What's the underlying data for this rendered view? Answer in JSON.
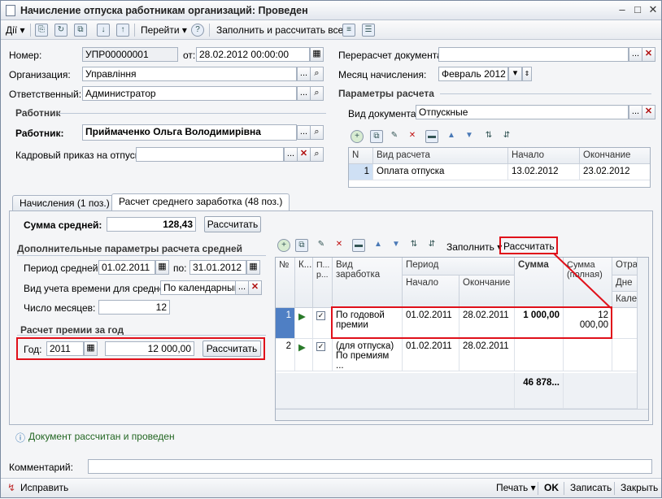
{
  "window": {
    "title": "Начисление отпуска работникам организаций: Проведен"
  },
  "toolbar": {
    "actions": "Дії",
    "goto": "Перейти",
    "fill_calc": "Заполнить и рассчитать все"
  },
  "header": {
    "number_label": "Номер:",
    "number": "УПР00000001",
    "date_label": "от:",
    "date": "28.02.2012 00:00:00",
    "org_label": "Организация:",
    "org": "Управління",
    "resp_label": "Ответственный:",
    "resp": "Администратор",
    "recalc_label": "Перерасчет документа:",
    "recalc": "",
    "month_label": "Месяц начисления:",
    "month": "Февраль 2012"
  },
  "worker": {
    "section": "Работник",
    "label": "Работник:",
    "name": "Приймаченко Ольга Володимирівна",
    "order_label": "Кадровый приказ на отпуск:",
    "order": ""
  },
  "calc_params": {
    "section": "Параметры расчета",
    "doc_type_label": "Вид документа:",
    "doc_type": "Отпускные",
    "columns": [
      "N",
      "Вид расчета",
      "Начало",
      "Окончание"
    ],
    "rows": [
      {
        "n": "1",
        "kind": "Оплата отпуска",
        "start": "13.02.2012",
        "end": "23.02.2012"
      }
    ]
  },
  "tabs": {
    "accruals": "Начисления (1 поз.)",
    "avg": "Расчет среднего заработка (48 поз.)"
  },
  "avg": {
    "sum_label": "Сумма средней:",
    "sum": "128,43",
    "calc": "Рассчитать",
    "extra_section": "Дополнительные параметры расчета средней",
    "period_label": "Период средней:",
    "period_from": "01.02.2011",
    "period_to_label": "по:",
    "period_to": "31.01.2012",
    "time_label": "Вид учета времени для средней:",
    "time": "По календарным",
    "months_label": "Число месяцев:",
    "months": "12",
    "bonus_section": "Расчет премии за год",
    "year_label": "Год:",
    "year": "2011",
    "bonus_amount": "12 000,00",
    "bonus_calc": "Рассчитать"
  },
  "earn_toolbar": {
    "fill": "Заполнить",
    "calc": "Рассчитать"
  },
  "earn_grid": {
    "h_n": "№",
    "h_k": "К...",
    "h_p": "П... р...",
    "h_kind": "Вид заработка",
    "h_period": "Период",
    "h_start": "Начало",
    "h_end": "Окончание",
    "h_sum": "Сумма",
    "h_full": "Сумма (полная)",
    "h_o": "Отра",
    "h_d": "Дне",
    "h_c": "Кале",
    "rows": [
      {
        "n": "1",
        "kind": "По годовой премии",
        "start": "01.02.2011",
        "end": "28.02.2011",
        "sum": "1 000,00",
        "full": "12 000,00"
      },
      {
        "n": "2",
        "kind": "(для отпуска) По премиям ...",
        "start": "01.02.2011",
        "end": "28.02.2011",
        "sum": "",
        "full": ""
      }
    ],
    "total": "46 878..."
  },
  "info": "Документ рассчитан и проведен",
  "comment_label": "Комментарий:",
  "comment": "",
  "bottom": {
    "fix": "Исправить",
    "print": "Печать",
    "ok": "OK",
    "save": "Записать",
    "close": "Закрыть"
  }
}
